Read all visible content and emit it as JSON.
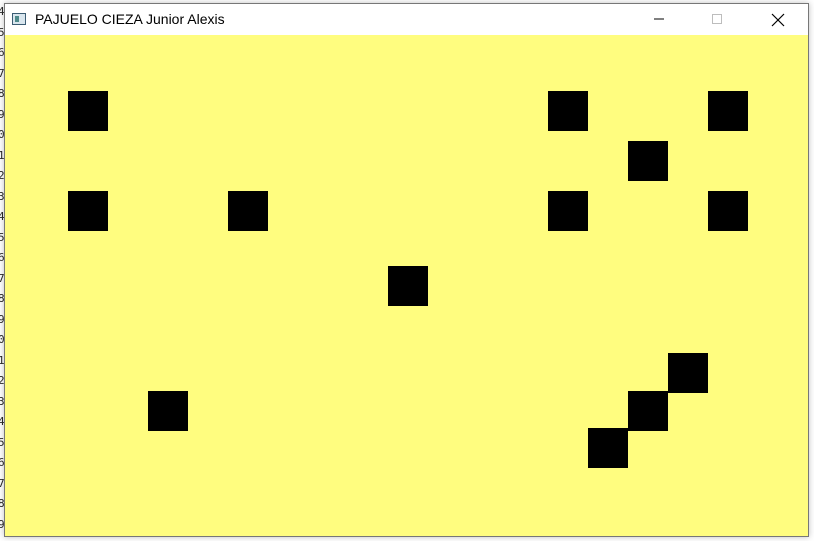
{
  "window": {
    "title": "PAJUELO CIEZA Junior Alexis"
  },
  "colors": {
    "canvas_bg": "#FFFD7F",
    "block": "#000000"
  },
  "background_editor": {
    "line_numbers": [
      "4",
      "5",
      "6",
      "7",
      "8",
      "9",
      "0",
      "1",
      "2",
      "3",
      "4",
      "5",
      "6",
      "7",
      "8",
      "9",
      "0",
      "1",
      "2",
      "3",
      "4",
      "5",
      "6",
      "7",
      "8",
      "9"
    ]
  },
  "blocks": [
    {
      "col": 1,
      "row": 1
    },
    {
      "col": 13,
      "row": 1
    },
    {
      "col": 17,
      "row": 1
    },
    {
      "col": 15,
      "row": 2
    },
    {
      "col": 1,
      "row": 3
    },
    {
      "col": 5,
      "row": 3
    },
    {
      "col": 13,
      "row": 3
    },
    {
      "col": 17,
      "row": 3
    },
    {
      "col": 9,
      "row": 4
    },
    {
      "col": 16,
      "row": 6
    },
    {
      "col": 3,
      "row": 7
    },
    {
      "col": 15,
      "row": 7
    },
    {
      "col": 14,
      "row": 8
    }
  ]
}
